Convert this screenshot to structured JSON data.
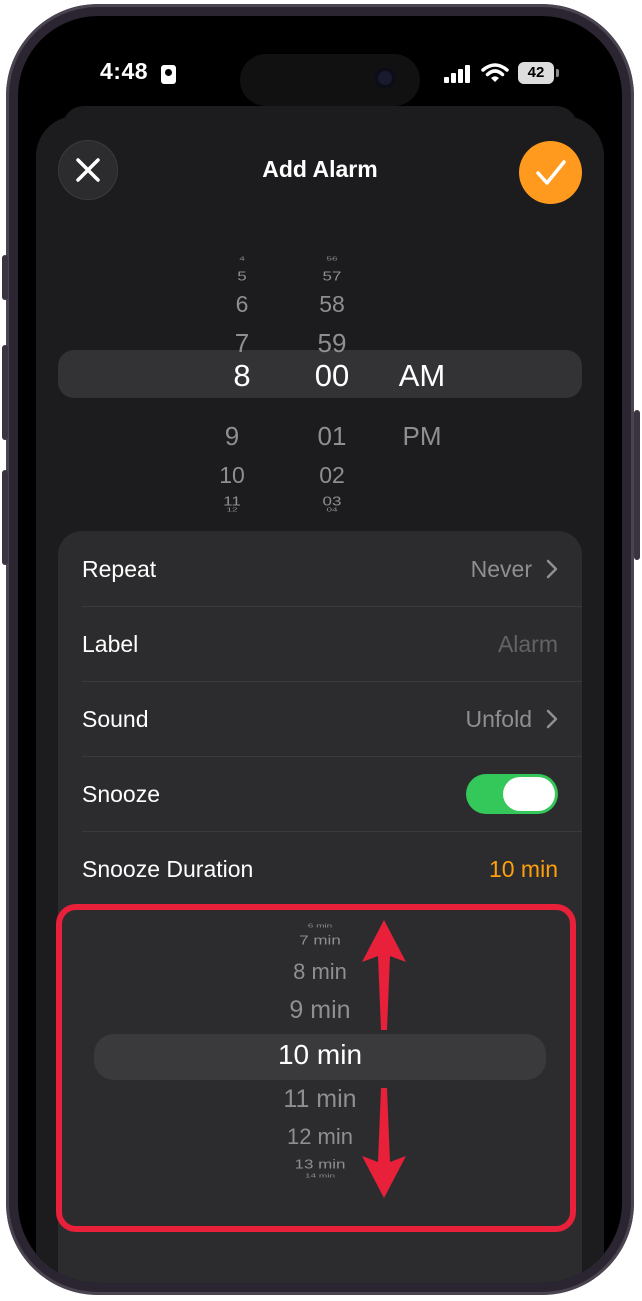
{
  "status_bar": {
    "time": "4:48",
    "battery": "42"
  },
  "sheet": {
    "title": "Add Alarm"
  },
  "time_picker": {
    "hours": [
      "4",
      "5",
      "6",
      "7",
      "8",
      "9",
      "10",
      "11",
      "12"
    ],
    "minutes": [
      "56",
      "57",
      "58",
      "59",
      "00",
      "01",
      "02",
      "03",
      "04"
    ],
    "periods": [
      "AM",
      "PM"
    ],
    "selected_hour": "8",
    "selected_minute": "00",
    "selected_period": "AM"
  },
  "settings": {
    "repeat": {
      "label": "Repeat",
      "value": "Never"
    },
    "label": {
      "label": "Label",
      "placeholder": "Alarm"
    },
    "sound": {
      "label": "Sound",
      "value": "Unfold"
    },
    "snooze": {
      "label": "Snooze",
      "on": true
    },
    "snooze_duration": {
      "label": "Snooze Duration",
      "value": "10 min"
    }
  },
  "snooze_picker": {
    "items": [
      "6 min",
      "7 min",
      "8 min",
      "9 min",
      "10 min",
      "11 min",
      "12 min",
      "13 min",
      "14 min"
    ],
    "selected": "10 min"
  },
  "colors": {
    "accent": "#ff9f0a",
    "toggle_on": "#34c759",
    "annotation": "#e8203a",
    "sheet_bg": "#1c1c1e"
  }
}
